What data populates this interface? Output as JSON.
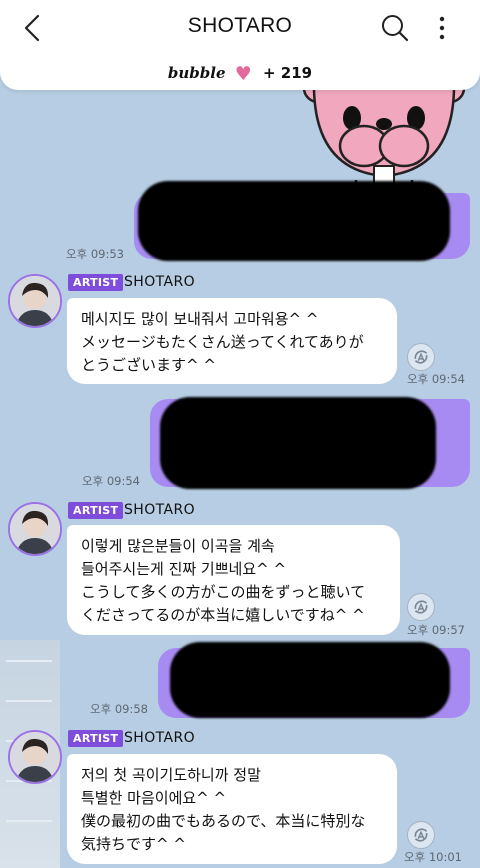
{
  "header": {
    "title": "SHOTARO"
  },
  "bubble_bar": {
    "brand": "bubble",
    "count": "+ 219"
  },
  "messages": [
    {
      "side": "out",
      "time": "오후 09:53"
    },
    {
      "side": "in",
      "badge": "ARTIST",
      "sender": "SHOTARO",
      "lines": [
        "메시지도 많이 보내줘서 고마워용^ ^",
        "メッセージもたくさん送ってくれてありが",
        "とうございます^ ^"
      ],
      "time": "오후 09:54"
    },
    {
      "side": "out",
      "time": "오후 09:54"
    },
    {
      "side": "in",
      "badge": "ARTIST",
      "sender": "SHOTARO",
      "lines": [
        "이렇게 많은분들이 이곡을 계속",
        "들어주시는게 진짜 기쁘네요^ ^",
        "こうして多くの方がこの曲をずっと聴いて",
        "くださってるのが本当に嬉しいですね^ ^"
      ],
      "time": "오후 09:57"
    },
    {
      "side": "out",
      "time": "오후 09:58"
    },
    {
      "side": "in",
      "badge": "ARTIST",
      "sender": "SHOTARO",
      "lines": [
        "저의 첫 곡이기도하니까 정말",
        "특별한 마음이에요^ ^",
        "僕の最初の曲でもあるので、本当に特別な",
        "気持ちです^ ^"
      ],
      "time": "오후 10:01"
    }
  ],
  "colors": {
    "accent": "#7e4ddb",
    "outgoing": "#a78bf2",
    "background": "#b7cde3"
  },
  "icons": [
    "back-arrow-icon",
    "search-icon",
    "more-vertical-icon",
    "heart-icon",
    "translate-icon"
  ]
}
